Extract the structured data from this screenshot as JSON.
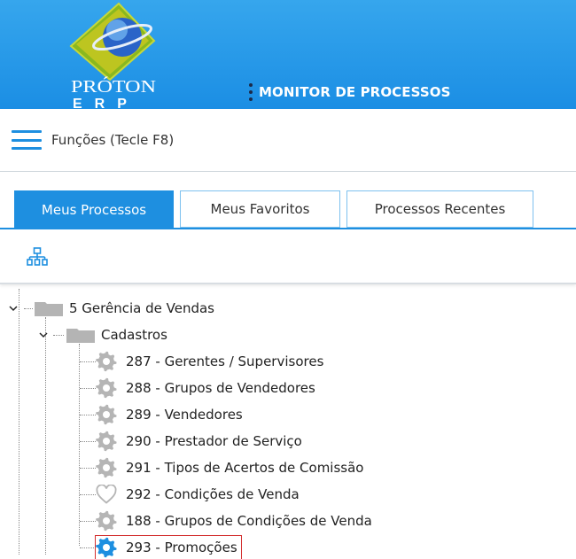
{
  "header": {
    "logo_brand": "PRÓTON",
    "logo_sub": "ERP",
    "menu_title": "MONITOR DE PROCESSOS"
  },
  "functions_bar": {
    "label": "Funções (Tecle F8)"
  },
  "tabs": [
    {
      "label": "Meus Processos",
      "active": true
    },
    {
      "label": "Meus Favoritos",
      "active": false
    },
    {
      "label": "Processos Recentes",
      "active": false
    }
  ],
  "tree": {
    "root": {
      "label": "5 Gerência de Vendas"
    },
    "group": {
      "label": "Cadastros"
    },
    "items": [
      {
        "label": "287 - Gerentes / Supervisores",
        "icon": "gear-icon"
      },
      {
        "label": "288 - Grupos de Vendedores",
        "icon": "gear-icon"
      },
      {
        "label": "289 - Vendedores",
        "icon": "gear-icon"
      },
      {
        "label": "290 - Prestador de Serviço",
        "icon": "gear-icon"
      },
      {
        "label": "291 - Tipos de Acertos de Comissão",
        "icon": "gear-icon"
      },
      {
        "label": "292 - Condições de Venda",
        "icon": "heart-icon"
      },
      {
        "label": "188 - Grupos de Condições de Venda",
        "icon": "gear-icon"
      },
      {
        "label": "293 - Promoções",
        "icon": "gear-icon",
        "selected": true
      }
    ]
  },
  "colors": {
    "header_blue": "#1b8ee4",
    "accent_blue": "#1e8fe0",
    "gear_gray": "#b5b5b5",
    "selection_red": "#d32f2f"
  }
}
